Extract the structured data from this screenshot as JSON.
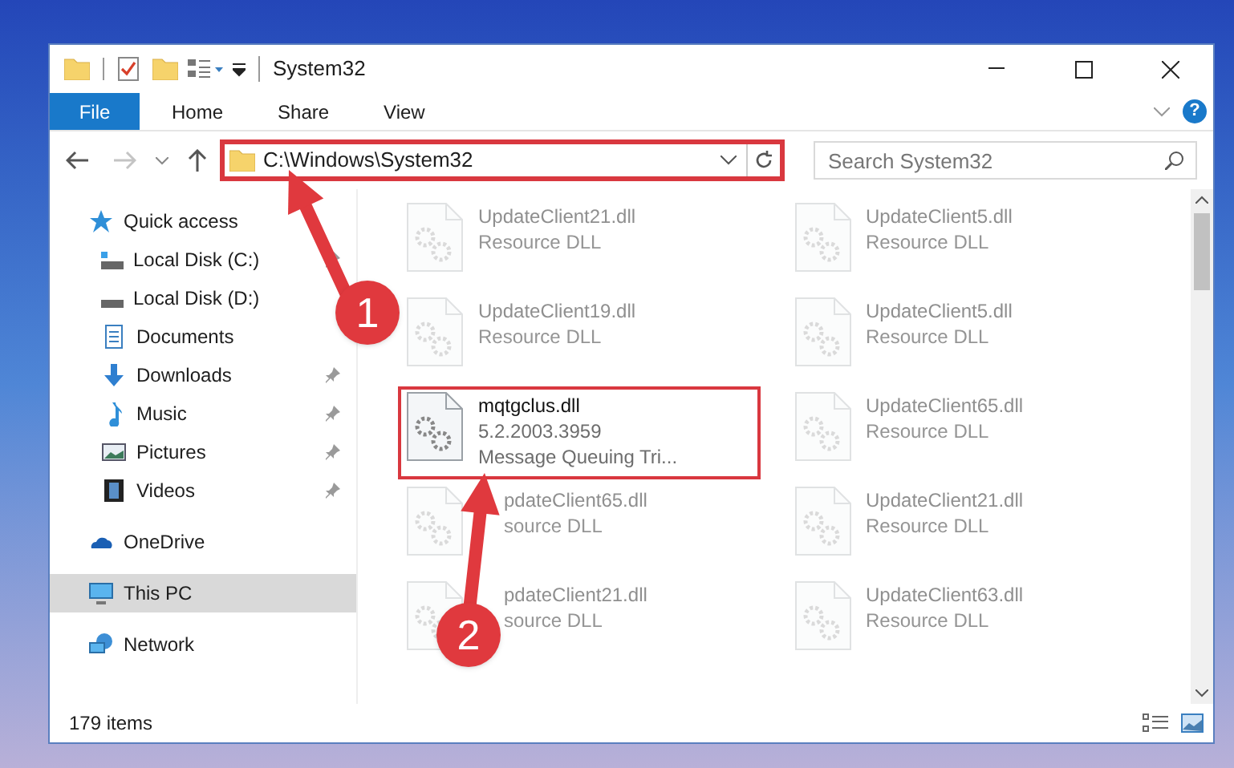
{
  "window": {
    "title": "System32"
  },
  "ribbon": {
    "tabs": [
      {
        "label": "File",
        "kind": "file"
      },
      {
        "label": "Home",
        "kind": "tab"
      },
      {
        "label": "Share",
        "kind": "tab"
      },
      {
        "label": "View",
        "kind": "tab"
      }
    ],
    "help": "?"
  },
  "address_bar": {
    "path": "C:\\Windows\\System32"
  },
  "search": {
    "placeholder": "Search System32"
  },
  "navigation": [
    {
      "label": "Quick access",
      "selected": false,
      "children": [
        {
          "label": "Local Disk (C:)",
          "pinned": true
        },
        {
          "label": "Local Disk (D:)",
          "pinned": false
        },
        {
          "label": "Documents",
          "pinned": false
        },
        {
          "label": "Downloads",
          "pinned": true
        },
        {
          "label": "Music",
          "pinned": true
        },
        {
          "label": "Pictures",
          "pinned": true
        },
        {
          "label": "Videos",
          "pinned": true
        }
      ]
    },
    {
      "label": "OneDrive",
      "selected": false
    },
    {
      "label": "This PC",
      "selected": true
    },
    {
      "label": "Network",
      "selected": false
    }
  ],
  "files": [
    {
      "name": "UpdateClient21.dll",
      "lines": [
        "Resource DLL"
      ],
      "dimmed": true
    },
    {
      "name": "UpdateClient5.dll",
      "lines": [
        "Resource DLL"
      ],
      "dimmed": true
    },
    {
      "name": "UpdateClient19.dll",
      "lines": [
        "Resource DLL"
      ],
      "dimmed": true
    },
    {
      "name": "UpdateClient5.dll",
      "lines": [
        "Resource DLL"
      ],
      "dimmed": true
    },
    {
      "name": "mqtgclus.dll",
      "lines": [
        "5.2.2003.3959",
        "Message Queuing Tri..."
      ],
      "dimmed": false
    },
    {
      "name": "UpdateClient65.dll",
      "lines": [
        "Resource DLL"
      ],
      "dimmed": true
    },
    {
      "name": "pdateClient65.dll",
      "lines": [
        "source DLL"
      ],
      "dimmed": true,
      "kind": "covered"
    },
    {
      "name": "UpdateClient21.dll",
      "lines": [
        "Resource DLL"
      ],
      "dimmed": true
    },
    {
      "name": "pdateClient21.dll",
      "lines": [
        "source DLL"
      ],
      "dimmed": true,
      "kind": "covered"
    },
    {
      "name": "UpdateClient63.dll",
      "lines": [
        "Resource DLL"
      ],
      "dimmed": true
    }
  ],
  "status_bar": {
    "count": "179 items"
  },
  "callouts": [
    {
      "number": "1"
    },
    {
      "number": "2"
    }
  ]
}
